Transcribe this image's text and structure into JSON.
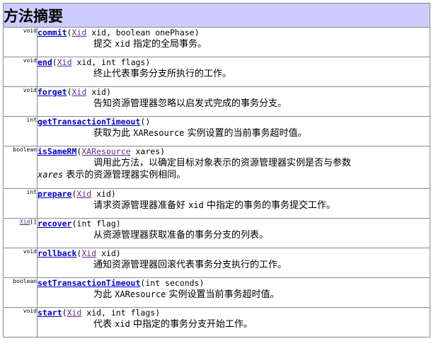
{
  "section_title": "方法摘要",
  "methods": [
    {
      "return_type": "void",
      "name": "commit",
      "sig_open": "(",
      "param1_type": "Xid",
      "sig_rest": " xid, boolean onePhase)",
      "desc_pre": "提交 ",
      "desc_code": "xid",
      "desc_post": " 指定的全局事务。"
    },
    {
      "return_type": "void",
      "name": "end",
      "sig_open": "(",
      "param1_type": "Xid",
      "sig_rest": " xid, int flags)",
      "desc": "终止代表事务分支所执行的工作。"
    },
    {
      "return_type": "void",
      "name": "forget",
      "sig_open": "(",
      "param1_type": "Xid",
      "sig_rest": " xid)",
      "desc": "告知资源管理器忽略以启发式完成的事务分支。"
    },
    {
      "return_type": "int",
      "name": "getTransactionTimeout",
      "sig_rest": "()",
      "desc_pre": "获取为此 ",
      "desc_code": "XAResource",
      "desc_post": " 实例设置的当前事务超时值。"
    },
    {
      "return_type": "boolean",
      "name": "isSameRM",
      "sig_open": "(",
      "param1_type": "XAResource",
      "sig_rest": " xares)",
      "desc_line1": "调用此方法，以确定目标对象表示的资源管理器实例是否与参数",
      "desc_line2_code": "xares",
      "desc_line2_post": " 表示的资源管理器实例相同。"
    },
    {
      "return_type": "int",
      "name": "prepare",
      "sig_open": "(",
      "param1_type": "Xid",
      "sig_rest": " xid)",
      "desc_pre": "请求资源管理器准备好 ",
      "desc_code": "xid",
      "desc_post": " 中指定的事务的事务提交工作。"
    },
    {
      "return_type_link": "Xid",
      "return_type_suffix": "[]",
      "name": "recover",
      "sig_rest": "(int flag)",
      "desc": "从资源管理器获取准备的事务分支的列表。"
    },
    {
      "return_type": "void",
      "name": "rollback",
      "sig_open": "(",
      "param1_type": "Xid",
      "sig_rest": " xid)",
      "desc": "通知资源管理器回滚代表事务分支执行的工作。"
    },
    {
      "return_type": "boolean",
      "name": "setTransactionTimeout",
      "sig_rest": "(int seconds)",
      "desc_pre": "为此 ",
      "desc_code": "XAResource",
      "desc_post": " 实例设置当前事务超时值。"
    },
    {
      "return_type": "void",
      "name": "start",
      "sig_open": "(",
      "param1_type": "Xid",
      "sig_rest": " xid, int flags)",
      "desc_pre": "代表 ",
      "desc_code": "xid",
      "desc_post": " 中指定的事务分支开始工作。"
    }
  ]
}
